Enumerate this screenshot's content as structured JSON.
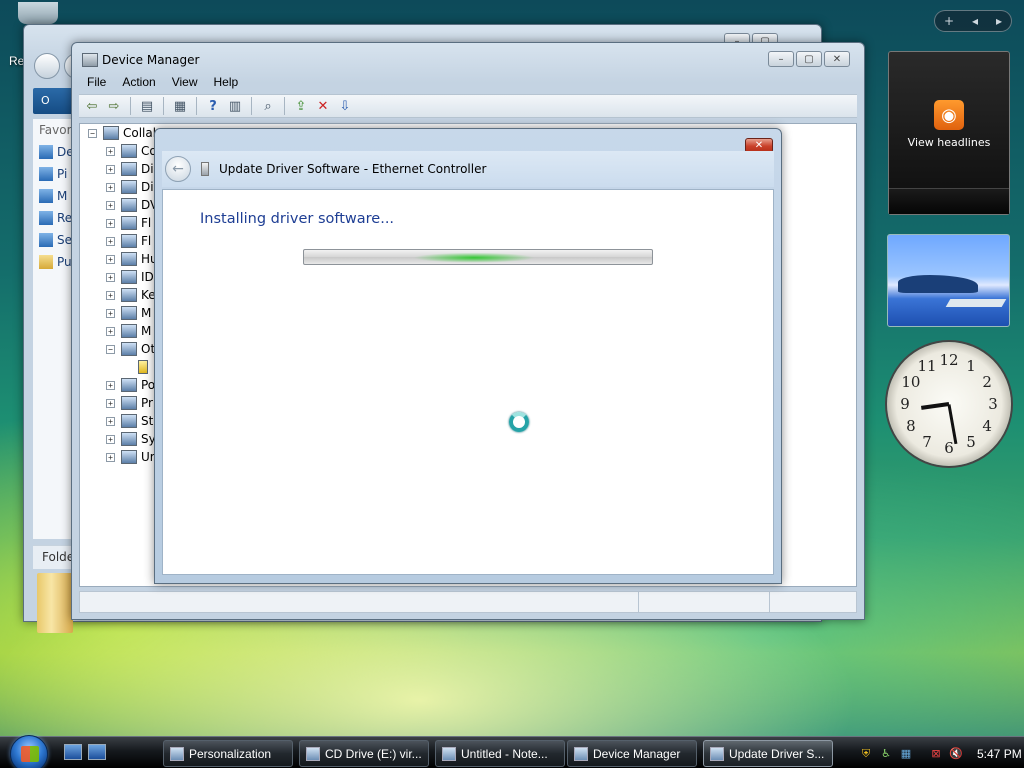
{
  "desktop": {
    "recycle_label": "Re"
  },
  "sidebar": {
    "toolbar": {
      "add": "+",
      "prev": "◂",
      "next": "▸"
    },
    "rss": {
      "label": "View headlines"
    },
    "clock": {
      "numbers": [
        "12",
        "1",
        "2",
        "3",
        "4",
        "5",
        "6",
        "7",
        "8",
        "9",
        "10",
        "11"
      ]
    }
  },
  "explorer": {
    "org_label": "O",
    "favorites_label": "Favor",
    "left_items": [
      "De",
      "Pi",
      "M",
      "Re",
      "Se",
      "Pu"
    ],
    "folders_label": "Folde"
  },
  "device_manager": {
    "title": "Device Manager",
    "menu": [
      "File",
      "Action",
      "View",
      "Help"
    ],
    "root": "Collab",
    "tree_items": [
      "Co",
      "Di",
      "Di",
      "DV",
      "Fl",
      "Fl",
      "Hu",
      "ID",
      "Ke",
      "M",
      "M",
      "Ot",
      "",
      "Po",
      "Pr",
      "St",
      "Sy",
      "Ur"
    ]
  },
  "dialog": {
    "title": "Update Driver Software - Ethernet Controller",
    "heading": "Installing driver software...",
    "close_glyph": "✕",
    "progress": "indeterminate"
  },
  "taskbar": {
    "tasks": [
      {
        "label": "Personalization",
        "active": false
      },
      {
        "label": "CD Drive (E:) vir...",
        "active": false
      },
      {
        "label": "Untitled - Note...",
        "active": false
      },
      {
        "label": "Device Manager",
        "active": false
      },
      {
        "label": "Update Driver S...",
        "active": true
      }
    ],
    "time": "5:47 PM"
  },
  "colors": {
    "heading_blue": "#1e3e94",
    "progress_green": "#2dc82d",
    "spinner_teal": "#25a3a7",
    "rss_orange": "#f08a24"
  }
}
